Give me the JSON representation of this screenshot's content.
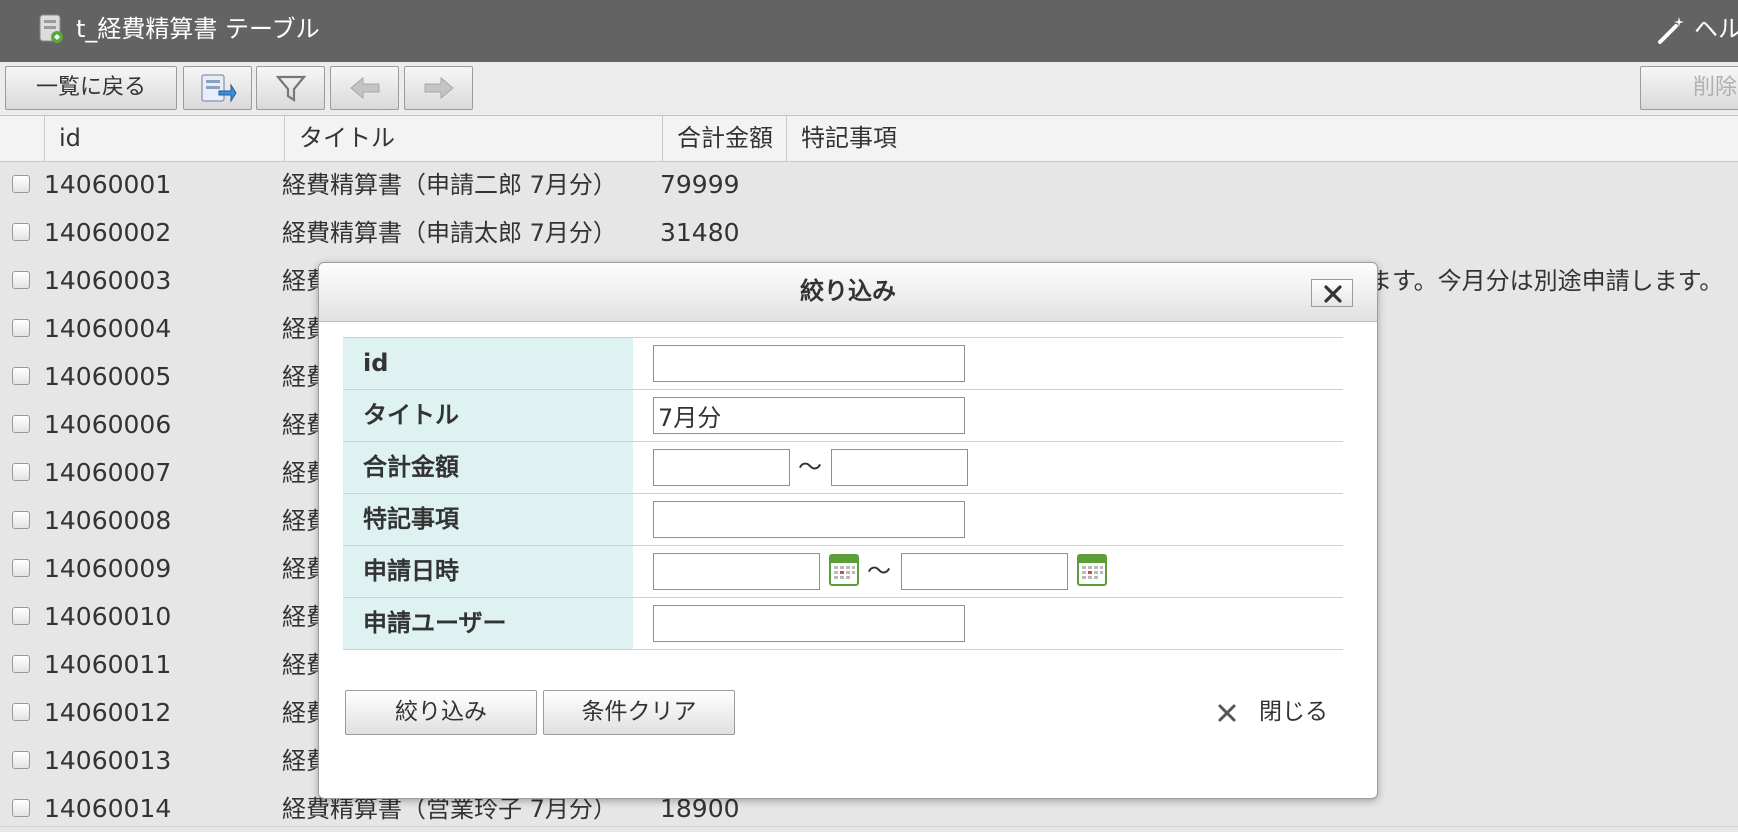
{
  "window": {
    "title": "t_経費精算書 テーブル",
    "help_label": "ヘルプ"
  },
  "toolbar": {
    "back_label": "一覧に戻る",
    "delete_label": "削除"
  },
  "table": {
    "columns": [
      "id",
      "タイトル",
      "合計金額",
      "特記事項"
    ],
    "rows": [
      {
        "id": "14060001",
        "title": "経費精算書（申請二郎 7月分）",
        "amount": "79999",
        "note": ""
      },
      {
        "id": "14060002",
        "title": "経費精算書（申請太郎 7月分）",
        "amount": "31480",
        "note": ""
      },
      {
        "id": "14060003",
        "title": "経費",
        "amount": "",
        "note": "ます。今月分は別途申請します。"
      },
      {
        "id": "14060004",
        "title": "経費",
        "amount": "",
        "note": ""
      },
      {
        "id": "14060005",
        "title": "経費",
        "amount": "",
        "note": ""
      },
      {
        "id": "14060006",
        "title": "経費",
        "amount": "",
        "note": ""
      },
      {
        "id": "14060007",
        "title": "経費",
        "amount": "",
        "note": ""
      },
      {
        "id": "14060008",
        "title": "経費",
        "amount": "",
        "note": ""
      },
      {
        "id": "14060009",
        "title": "経費",
        "amount": "",
        "note": ""
      },
      {
        "id": "14060010",
        "title": "経費",
        "amount": "",
        "note": ""
      },
      {
        "id": "14060011",
        "title": "経費",
        "amount": "",
        "note": ""
      },
      {
        "id": "14060012",
        "title": "経費",
        "amount": "",
        "note": ""
      },
      {
        "id": "14060013",
        "title": "経費",
        "amount": "",
        "note": ""
      },
      {
        "id": "14060014",
        "title": "経費精算書（営業玲子 7月分）",
        "amount": "18900",
        "note": ""
      }
    ]
  },
  "filter_dialog": {
    "title": "絞り込み",
    "fields": [
      {
        "label": "id",
        "value": ""
      },
      {
        "label": "タイトル",
        "value": "7月分"
      },
      {
        "label": "合計金額",
        "from": "",
        "to": "",
        "separator": "〜"
      },
      {
        "label": "特記事項",
        "value": ""
      },
      {
        "label": "申請日時",
        "from": "",
        "to": "",
        "separator": "〜"
      },
      {
        "label": "申請ユーザー",
        "value": ""
      }
    ],
    "apply_label": "絞り込み",
    "clear_label": "条件クリア",
    "close_label": "閉じる"
  },
  "colors": {
    "titlebar": "#636363",
    "label_bg": "#def2f2",
    "calendar_green": "#5c9e3a"
  }
}
